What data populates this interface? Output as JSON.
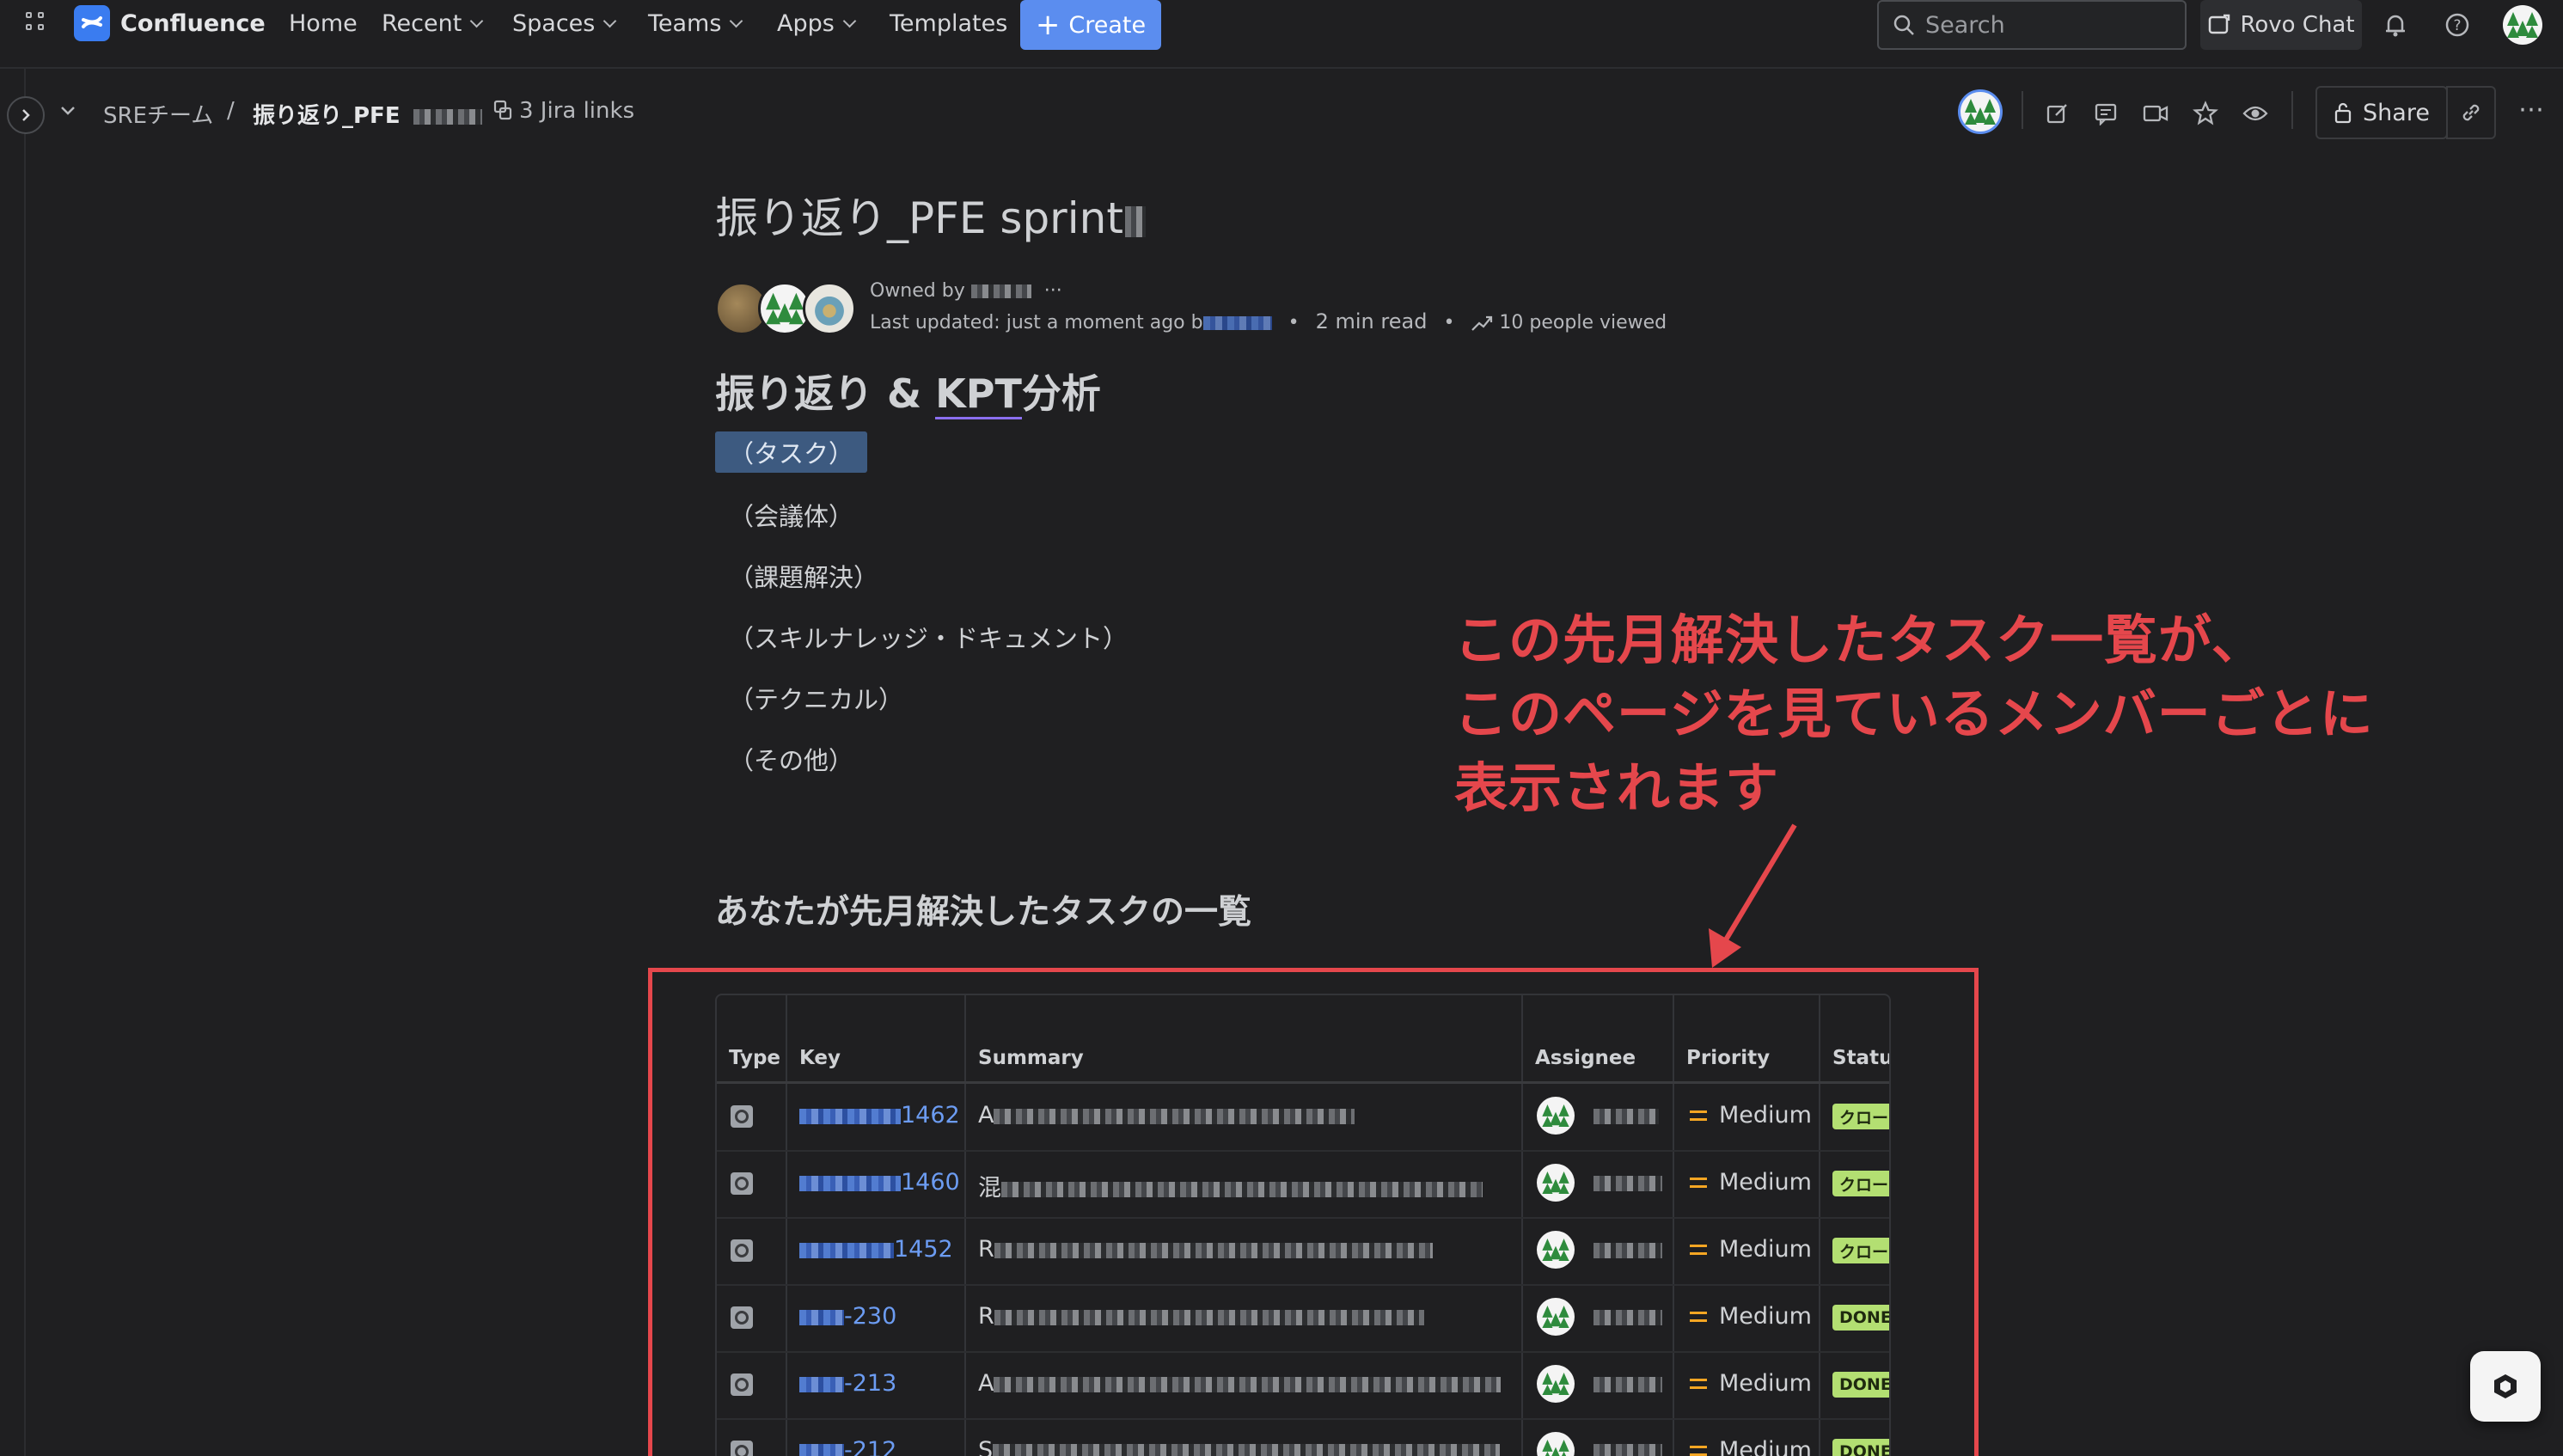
{
  "topnav": {
    "app_name": "Confluence",
    "items": [
      {
        "label": "Home"
      },
      {
        "label": "Recent"
      },
      {
        "label": "Spaces"
      },
      {
        "label": "Teams"
      },
      {
        "label": "Apps"
      },
      {
        "label": "Templates"
      }
    ],
    "create_label": "Create",
    "search_placeholder": "Search",
    "rovo_label": "Rovo Chat",
    "brand_color": "#3a7cf0",
    "icons": [
      "app-switcher-icon",
      "notifications-icon",
      "help-icon",
      "profile-avatar"
    ]
  },
  "breadcrumb": {
    "space": "SREチーム",
    "separator": "/",
    "page": "振り返り_PFE",
    "jira_links": "3 Jira links"
  },
  "toolbar": {
    "share_label": "Share",
    "icons": [
      "edit-icon",
      "comment-icon",
      "video-icon",
      "star-icon",
      "watch-icon",
      "copy-link-icon",
      "more-icon"
    ]
  },
  "page": {
    "title": "振り返り_PFE sprint",
    "owned_by_label": "Owned by",
    "last_updated": "Last updated: just a moment ago b",
    "read_time": "2 min read",
    "viewed": "10 people viewed",
    "dot": "•",
    "heading_prefix": "振り返り & ",
    "heading_kpt": "KPT",
    "heading_suffix": "分析",
    "highlighted_item": "（タスク）",
    "items": [
      "（会議体）",
      "（課題解決）",
      "（スキルナレッジ・ドキュメント）",
      "（テクニカル）",
      "（その他）"
    ],
    "section_heading": "あなたが先月解決したタスクの一覧"
  },
  "annotation": {
    "lines": [
      "この先月解決したタスク一覧が、",
      "このページを見ているメンバーごとに",
      "表示されます"
    ],
    "color": "#e5474c"
  },
  "jira_table": {
    "columns": [
      "Type",
      "Key",
      "Summary",
      "Assignee",
      "Priority",
      "Status"
    ],
    "rows": [
      {
        "key_suffix": "1462",
        "summary_start": "A",
        "priority": "Medium",
        "status": "クロー"
      },
      {
        "key_suffix": "1460",
        "summary_start": "混",
        "priority": "Medium",
        "status": "クロー"
      },
      {
        "key_suffix": "1452",
        "summary_start": "R",
        "priority": "Medium",
        "status": "クロー"
      },
      {
        "key_suffix": "-230",
        "summary_start": "R",
        "priority": "Medium",
        "status": "DONE"
      },
      {
        "key_suffix": "-213",
        "summary_start": "A",
        "priority": "Medium",
        "status": "DONE"
      },
      {
        "key_suffix": "-212",
        "summary_start": "S",
        "priority": "Medium",
        "status": "DONE"
      }
    ],
    "status_color": "#b3df72",
    "priority_color": "#f5a623"
  }
}
